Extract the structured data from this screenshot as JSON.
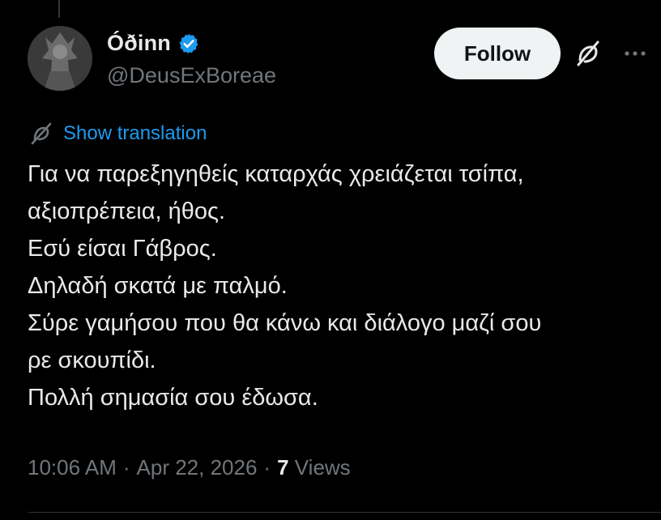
{
  "author": {
    "display_name": "Óðinn",
    "handle": "@DeusExBoreae",
    "verified": true
  },
  "actions": {
    "follow_label": "Follow",
    "grok_icon": "grok-icon",
    "more_icon": "more-icon"
  },
  "translation": {
    "label": "Show translation",
    "icon": "translate-icon"
  },
  "tweet": {
    "lines": [
      "Για να παρεξηγηθείς καταρχάς χρειάζεται τσίπα,",
      "αξιοπρέπεια, ήθος.",
      "Εσύ είσαι Γάβρος.",
      "Δηλαδή σκατά με παλμό.",
      "Σύρε γαμήσου που θα κάνω και διάλογο μαζί σου",
      "ρε σκουπίδι.",
      "Πολλή σημασία σου έδωσα."
    ]
  },
  "meta": {
    "time": "10:06 AM",
    "separator": "·",
    "date": "Apr 22, 2026",
    "views_count": "7",
    "views_label": "Views"
  },
  "colors": {
    "background": "#000000",
    "text": "#e7e9ea",
    "muted": "#71767b",
    "link": "#1d9bf0",
    "verified": "#1d9bf0"
  }
}
